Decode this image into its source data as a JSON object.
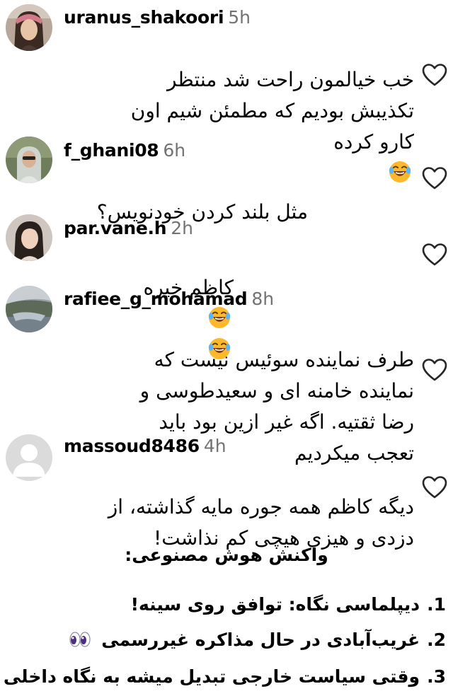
{
  "comments": [
    {
      "username": "uranus_shakoori",
      "time": "5h",
      "lines": "خب خیالمون راحت شد منتظر\nتکذیبش بودیم که مطمئن شیم اون\nکارو کرده",
      "emoji": "laughing-tears"
    },
    {
      "username": "f_ghani08",
      "time": "6h",
      "lines": "مثل بلند کردن خودنویس؟"
    },
    {
      "username": "par.vane.h",
      "time": "2h",
      "lines": "کاظم خیره"
    },
    {
      "username": "rafiee_g_mohamad",
      "time": "8h",
      "lines": "طرف نماینده سوئیس نیست که\nنماینده خامنه ای و سعیدطوسی و\nرضا ثقتیه. اگه غیر ازین بود باید\nتعجب میکردیم"
    },
    {
      "username": "massoud8486",
      "time": "4h",
      "lines": "دیگه کاظم همه جوره مایه گذاشته، از\nدزدی و هیزی هیچی کم نذاشت!"
    }
  ],
  "ai_section": {
    "title": "واکنش هوش مصنوعی:",
    "items": [
      {
        "num": "1.",
        "text": "دیپلماسی نگاه: توافق روی سینه!"
      },
      {
        "num": "2.",
        "text": "غریب‌آبادی در حال مذاکره غیررسمی",
        "icon": "eyes-emoji"
      },
      {
        "num": "3.",
        "text": "وقتی سیاست خارجی تبدیل میشه به نگاه داخلی"
      }
    ]
  },
  "icons": {
    "like": "heart-outline-icon",
    "laugh": "face-with-tears-of-joy-emoji"
  },
  "colors": {
    "text": "#000000",
    "time": "#737373",
    "icon_stroke": "#262626",
    "emoji_yellow": "#FDB82B"
  }
}
